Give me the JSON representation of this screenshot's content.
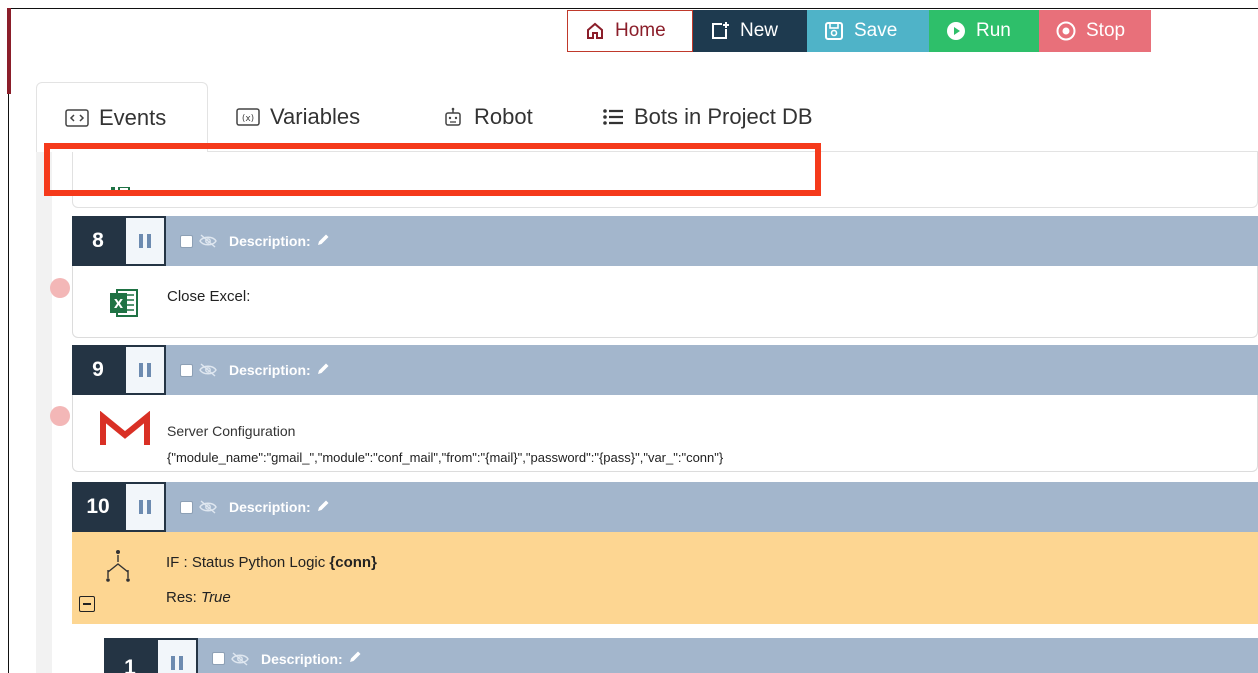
{
  "toolbar": {
    "home_label": "Home",
    "new_label": "New",
    "save_label": "Save",
    "run_label": "Run",
    "stop_label": "Stop"
  },
  "tabs": [
    {
      "label": "Events",
      "icon": "code-brackets-icon"
    },
    {
      "label": "Variables",
      "icon": "variable-icon"
    },
    {
      "label": "Robot",
      "icon": "robot-icon"
    },
    {
      "label": "Bots in Project DB",
      "icon": "list-icon"
    }
  ],
  "commands": [
    {
      "number": "8",
      "description_label": "Description:",
      "body_text": "Close Excel:",
      "icon": "excel-icon"
    },
    {
      "number": "9",
      "description_label": "Description:",
      "title": "Server Configuration",
      "detail": "{\"module_name\":\"gmail_\",\"module\":\"conf_mail\",\"from\":\"{mail}\",\"password\":\"{pass}\",\"var_\":\"conn\"}",
      "icon": "gmail-icon"
    },
    {
      "number": "10",
      "description_label": "Description:",
      "if_prefix": "IF : Status Python Logic ",
      "if_var": "{conn}",
      "res_label": "Res: ",
      "res_value": "True",
      "icon": "flow-branch-icon"
    },
    {
      "number": "1",
      "description_label": "Description:"
    }
  ],
  "colors": {
    "header_bg": "#a3b6cc",
    "number_bg": "#243444",
    "if_bg": "#fdd692",
    "highlight": "#f53a1b"
  }
}
